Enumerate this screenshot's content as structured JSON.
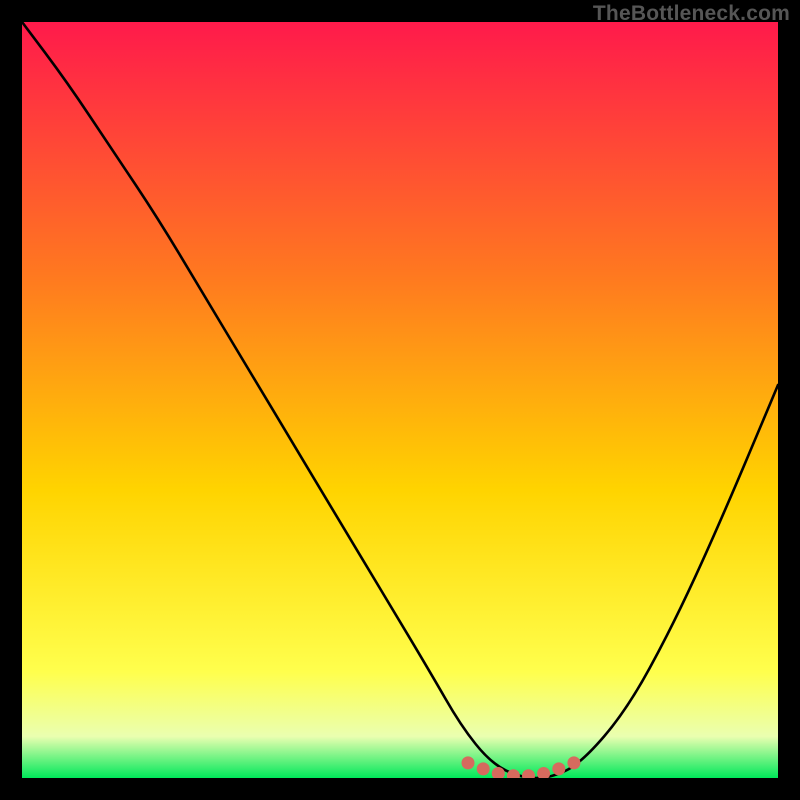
{
  "attribution": "TheBottleneck.com",
  "colors": {
    "bg": "#000000",
    "grad_top": "#ff1a4b",
    "grad_mid1": "#ff7a1f",
    "grad_mid2": "#ffd400",
    "grad_low": "#ffff4d",
    "grad_base_pale": "#eaffb0",
    "grad_base_green": "#00e85a",
    "curve": "#000000",
    "marker": "#d66a5e"
  },
  "chart_data": {
    "type": "line",
    "title": "",
    "xlabel": "",
    "ylabel": "",
    "xlim": [
      0,
      100
    ],
    "ylim": [
      0,
      100
    ],
    "series": [
      {
        "name": "bottleneck-curve",
        "x": [
          0,
          6,
          12,
          18,
          24,
          30,
          36,
          42,
          48,
          54,
          58,
          62,
          66,
          70,
          74,
          80,
          86,
          92,
          100
        ],
        "y": [
          100,
          92,
          83,
          74,
          64,
          54,
          44,
          34,
          24,
          14,
          7,
          2,
          0,
          0,
          2,
          9,
          20,
          33,
          52
        ]
      }
    ],
    "markers": {
      "name": "valley-highlight",
      "x": [
        59,
        61,
        63,
        65,
        67,
        69,
        71,
        73
      ],
      "y": [
        2.0,
        1.2,
        0.6,
        0.3,
        0.3,
        0.6,
        1.2,
        2.0
      ]
    },
    "gradient_stops": [
      {
        "offset": 0.0,
        "key": "grad_top"
      },
      {
        "offset": 0.34,
        "key": "grad_mid1"
      },
      {
        "offset": 0.62,
        "key": "grad_mid2"
      },
      {
        "offset": 0.86,
        "key": "grad_low"
      },
      {
        "offset": 0.945,
        "key": "grad_base_pale"
      },
      {
        "offset": 1.0,
        "key": "grad_base_green"
      }
    ]
  }
}
